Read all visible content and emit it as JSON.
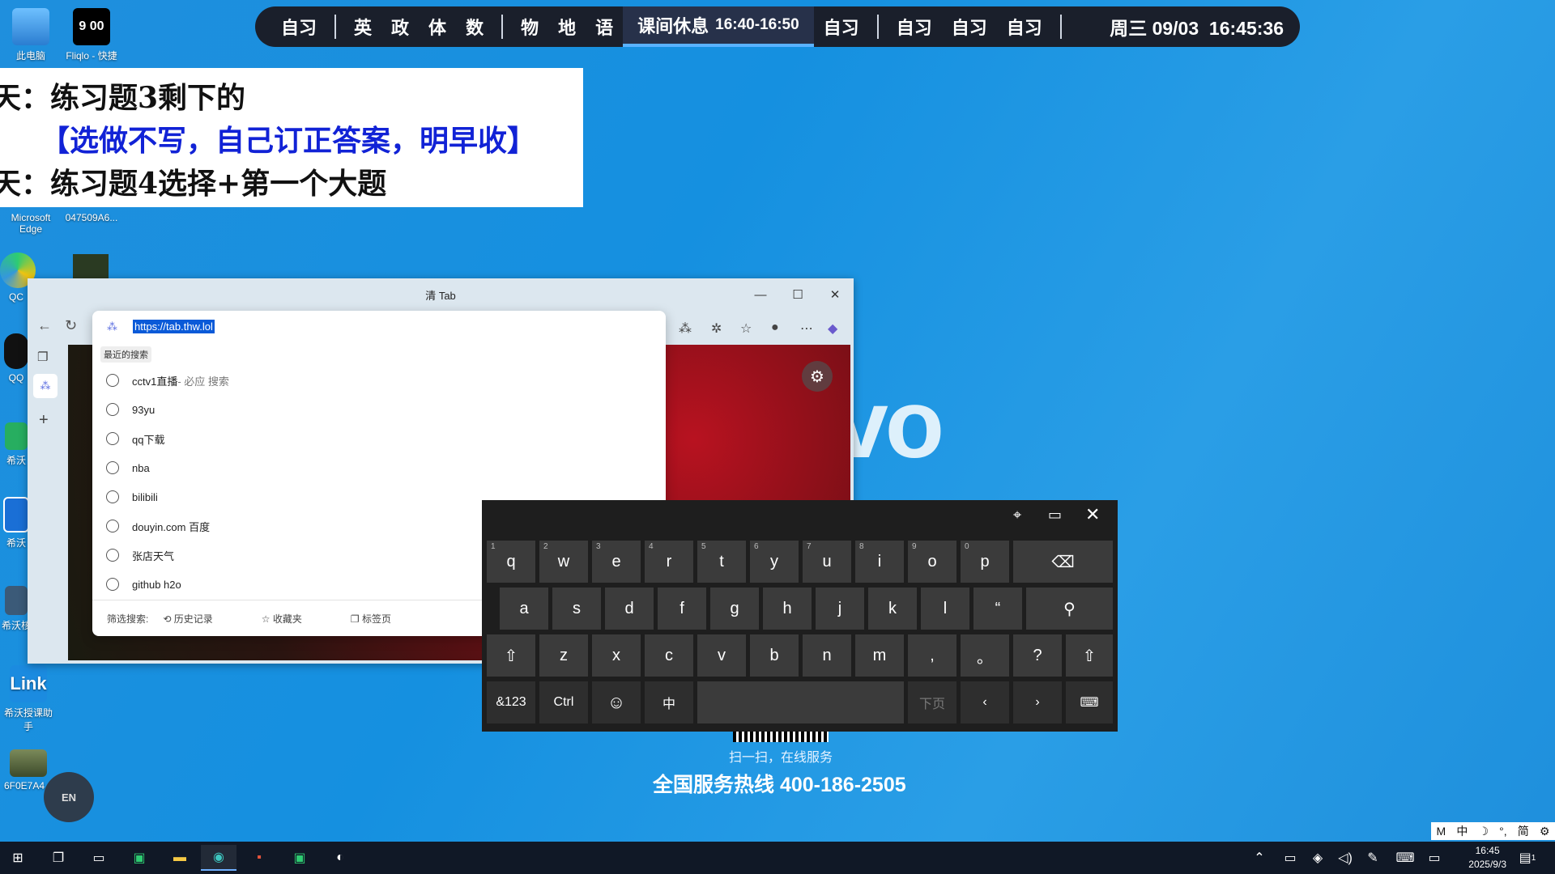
{
  "schedule": {
    "slots_left": [
      "自习"
    ],
    "group1": [
      "英",
      "政",
      "体",
      "数"
    ],
    "group2": [
      "物",
      "地",
      "语"
    ],
    "current_label": "课间休息",
    "current_time": "16:40-16:50",
    "after_current": [
      "自习"
    ],
    "group3": [
      "自习",
      "自习",
      "自习"
    ],
    "date": "周三 09/03",
    "clock": "16:45:36"
  },
  "desktop_icons": {
    "this_pc": "此电脑",
    "fliqlo": "Fliqlo - 快捷",
    "fliqlo_display": "9 00",
    "edge": "Microsoft Edge",
    "image1": "047509A6...",
    "qq_partial": "QC",
    "qq2_partial": "QQ",
    "xiwo1": "希沃",
    "xiwo2": "希沃",
    "xiwo3": "希沃核",
    "link": "希沃授课助手",
    "link_text": "Link",
    "image2": "6F0E7A4..."
  },
  "homework": {
    "line1": "天：练习题3剩下的",
    "line2": "【选做不写，自己订正答案，明早收】",
    "line3": "天：练习题4选择+第一个大题"
  },
  "background": {
    "brand_fragment": "vo",
    "service": "扫一扫，在线服务",
    "hotline": "全国服务热线 400-186-2505"
  },
  "browser": {
    "title": "清 Tab",
    "url": "https://tab.thw.lol",
    "recent_header": "最近的搜索",
    "suggestions": [
      {
        "text": "cctv1直播",
        "suffix": " - 必应 搜索"
      },
      {
        "text": "93yu",
        "suffix": ""
      },
      {
        "text": "qq下载",
        "suffix": ""
      },
      {
        "text": "nba",
        "suffix": ""
      },
      {
        "text": "bilibili",
        "suffix": ""
      },
      {
        "text": "douyin.com 百度",
        "suffix": ""
      },
      {
        "text": "张店天气",
        "suffix": ""
      },
      {
        "text": "github h2o",
        "suffix": ""
      }
    ],
    "filter_label": "筛选搜索:",
    "filter_history": "历史记录",
    "filter_favorites": "收藏夹",
    "filter_tabs": "标签页"
  },
  "keyboard": {
    "row1": [
      [
        "q",
        "1"
      ],
      [
        "w",
        "2"
      ],
      [
        "e",
        "3"
      ],
      [
        "r",
        "4"
      ],
      [
        "t",
        "5"
      ],
      [
        "y",
        "6"
      ],
      [
        "u",
        "7"
      ],
      [
        "i",
        "8"
      ],
      [
        "o",
        "9"
      ],
      [
        "p",
        "0"
      ]
    ],
    "row2": [
      "a",
      "s",
      "d",
      "f",
      "g",
      "h",
      "j",
      "k",
      "l",
      "“"
    ],
    "row3": [
      "z",
      "x",
      "c",
      "v",
      "b",
      "n",
      "m",
      ",",
      "。",
      "?"
    ],
    "sym": "&123",
    "ctrl": "Ctrl",
    "lang": "中",
    "page": "下页"
  },
  "ime": {
    "float_label": "EN",
    "bar": [
      "M",
      "中",
      "简"
    ]
  },
  "taskbar": {
    "time": "16:45",
    "date": "2025/9/3",
    "notif_count": "1"
  }
}
